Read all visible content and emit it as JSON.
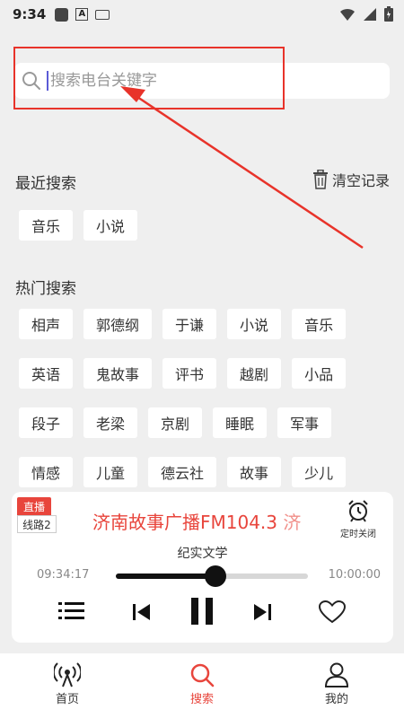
{
  "status_bar": {
    "time": "9:34"
  },
  "search": {
    "placeholder": "搜索电台关键字"
  },
  "recent": {
    "title": "最近搜索",
    "clear_label": "清空记录",
    "tags": [
      "音乐",
      "小说"
    ]
  },
  "hot": {
    "title": "热门搜索",
    "rows": [
      [
        "相声",
        "郭德纲",
        "于谦",
        "小说",
        "音乐"
      ],
      [
        "英语",
        "鬼故事",
        "评书",
        "越剧",
        "小品"
      ],
      [
        "段子",
        "老梁",
        "京剧",
        "睡眠",
        "军事"
      ],
      [
        "情感",
        "儿童",
        "德云社",
        "故事",
        "少儿"
      ]
    ]
  },
  "player": {
    "live_label": "直播",
    "line_label": "线路2",
    "station": "济南故事广播FM104.3",
    "station_tail": "济",
    "timer_label": "定时关闭",
    "program": "纪实文学",
    "current_time": "09:34:17",
    "end_time": "10:00:00",
    "progress": 0.52
  },
  "nav": {
    "items": [
      {
        "label": "首页",
        "icon": "radio-icon"
      },
      {
        "label": "搜索",
        "icon": "search-icon"
      },
      {
        "label": "我的",
        "icon": "user-icon"
      }
    ],
    "active_index": 1
  },
  "colors": {
    "accent": "#e8453c",
    "annotation": "#e8332a"
  }
}
